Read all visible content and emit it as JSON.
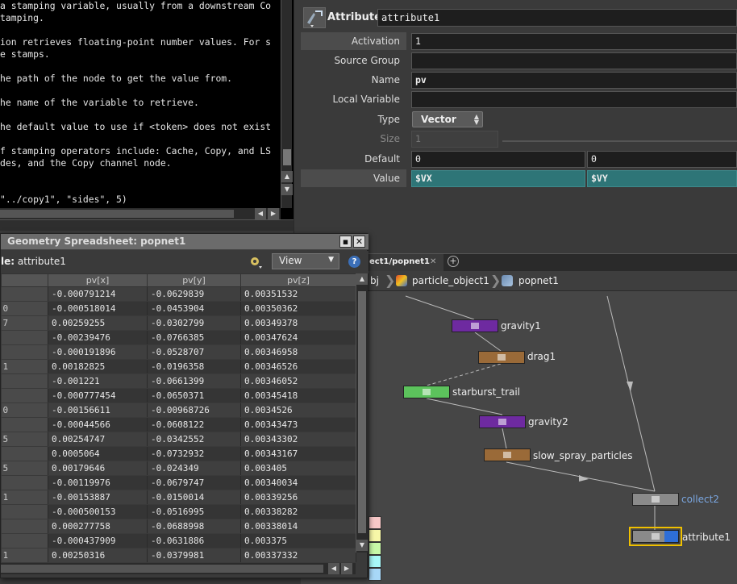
{
  "help": {
    "lines": [
      "a stamping variable, usually from a downstream Co",
      "tamping.",
      "",
      "ion retrieves floating-point number values. For s",
      "e stamps.",
      "",
      "he path of the node to get the value from.",
      "",
      "he name of the variable to retrieve.",
      "",
      "he default value to use if <token> does not exist",
      "",
      "f stamping operators include: Cache, Copy, and LS",
      "des, and the Copy channel node.",
      "",
      "",
      "\"../copy1\", \"sides\", 5)"
    ]
  },
  "params": {
    "op_type": "Attribute",
    "op_name": "attribute1",
    "rows": {
      "activation": {
        "label": "Activation",
        "value": "1"
      },
      "source_group": {
        "label": "Source Group",
        "value": ""
      },
      "name": {
        "label": "Name",
        "value": "pv"
      },
      "local_variable": {
        "label": "Local Variable",
        "value": ""
      },
      "type": {
        "label": "Type",
        "value": "Vector"
      },
      "size": {
        "label": "Size",
        "value": "1"
      },
      "default": {
        "label": "Default",
        "x": "0",
        "y": "0"
      },
      "value": {
        "label": "Value",
        "x": "$VX",
        "y": "$VY"
      }
    }
  },
  "network": {
    "active_tab": "ect1/popnet1",
    "breadcrumb": [
      "bj",
      "particle_object1",
      "popnet1"
    ],
    "nodes": [
      {
        "id": "gravity1",
        "label": "gravity1",
        "color": "#6e2aa0"
      },
      {
        "id": "drag1",
        "label": "drag1",
        "color": "#9a6a38"
      },
      {
        "id": "starburst_trail",
        "label": "starburst_trail",
        "color": "#5cc35c"
      },
      {
        "id": "gravity2",
        "label": "gravity2",
        "color": "#6e2aa0"
      },
      {
        "id": "slow_spray_particles",
        "label": "slow_spray_particles",
        "color": "#9a6a38"
      },
      {
        "id": "collect2",
        "label": "collect2",
        "color": "#8a8a8a"
      },
      {
        "id": "attribute1",
        "label": "attribute1",
        "color": "#8a8a8a"
      }
    ],
    "palette": [
      "#f8c8c8",
      "#f8f8a8",
      "#c8f8a8",
      "#a8f8f8",
      "#a8d8f8"
    ]
  },
  "spreadsheet": {
    "title": "Geometry Spreadsheet:  popnet1",
    "node_label": "le:",
    "node_name": "attribute1",
    "view_label": "View",
    "columns": [
      "",
      "pv[x]",
      "pv[y]",
      "pv[z]"
    ],
    "rows": [
      {
        "idx": "",
        "x": "-0.000791214",
        "y": "-0.0629839",
        "z": "0.00351532"
      },
      {
        "idx": "0",
        "x": "-0.000518014",
        "y": "-0.0453904",
        "z": "0.00350362"
      },
      {
        "idx": "7",
        "x": "0.00259255",
        "y": "-0.0302799",
        "z": "0.00349378"
      },
      {
        "idx": "",
        "x": "-0.00239476",
        "y": "-0.0766385",
        "z": "0.00347624"
      },
      {
        "idx": "",
        "x": "-0.000191896",
        "y": "-0.0528707",
        "z": "0.00346958"
      },
      {
        "idx": "1",
        "x": "0.00182825",
        "y": "-0.0196358",
        "z": "0.00346526"
      },
      {
        "idx": "",
        "x": "-0.001221",
        "y": "-0.0661399",
        "z": "0.00346052"
      },
      {
        "idx": "",
        "x": "-0.000777454",
        "y": "-0.0650371",
        "z": "0.00345418"
      },
      {
        "idx": "0",
        "x": "-0.00156611",
        "y": "-0.00968726",
        "z": "0.0034526"
      },
      {
        "idx": "",
        "x": "-0.00044566",
        "y": "-0.0608122",
        "z": "0.00343473"
      },
      {
        "idx": "5",
        "x": "0.00254747",
        "y": "-0.0342552",
        "z": "0.00343302"
      },
      {
        "idx": "",
        "x": "0.0005064",
        "y": "-0.0732932",
        "z": "0.00343167"
      },
      {
        "idx": "5",
        "x": "0.00179646",
        "y": "-0.024349",
        "z": "0.003405"
      },
      {
        "idx": "",
        "x": "-0.00119976",
        "y": "-0.0679747",
        "z": "0.00340034"
      },
      {
        "idx": "1",
        "x": "-0.00153887",
        "y": "-0.0150014",
        "z": "0.00339256"
      },
      {
        "idx": "",
        "x": "-0.000500153",
        "y": "-0.0516995",
        "z": "0.00338282"
      },
      {
        "idx": "",
        "x": "0.000277758",
        "y": "-0.0688998",
        "z": "0.00338014"
      },
      {
        "idx": "",
        "x": "-0.000437909",
        "y": "-0.0631886",
        "z": "0.003375"
      },
      {
        "idx": "1",
        "x": "0.00250316",
        "y": "-0.0379981",
        "z": "0.00337332"
      }
    ]
  }
}
